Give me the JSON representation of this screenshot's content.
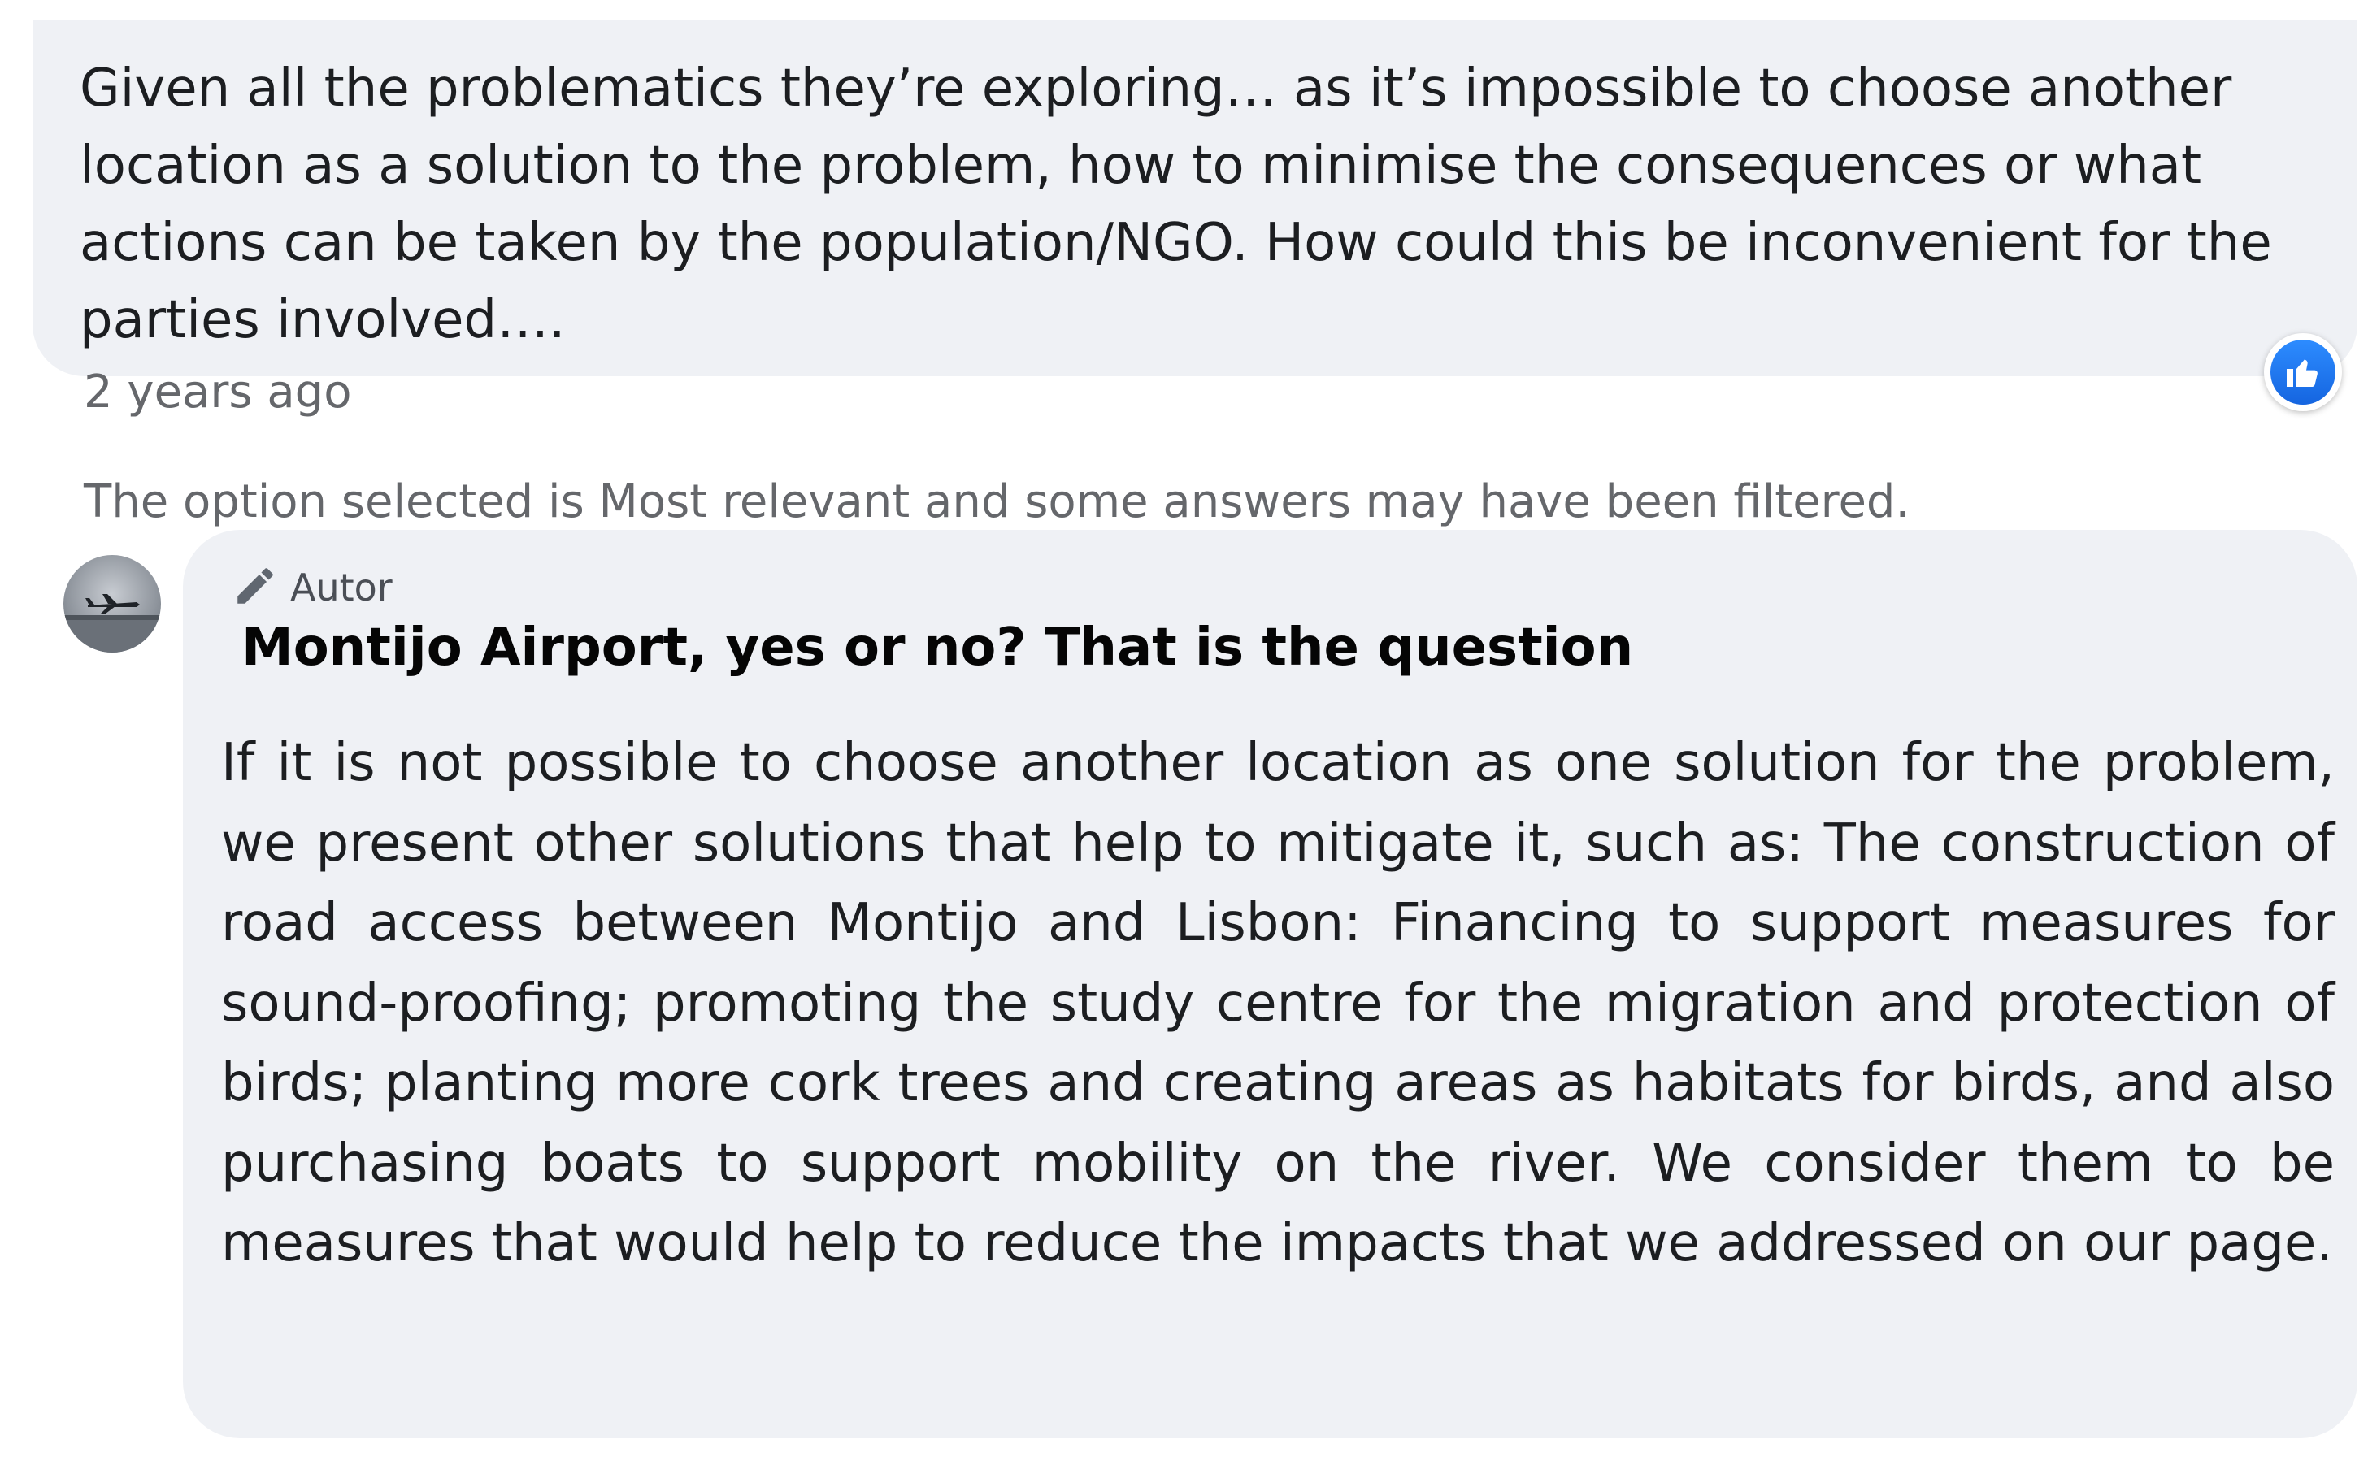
{
  "comment": {
    "text": "Given all the problematics they’re exploring… as it’s impossible to choose another location as a solution to the problem, how to minimise the consequences or what actions can be taken by the population/NGO. How could this be inconvenient for the parties involved….",
    "timestamp": "2 years ago",
    "reaction_icon": "like-icon"
  },
  "filter_note": "The option selected is Most relevant and some answers may have been filtered.",
  "reply": {
    "author_badge_icon": "pencil-icon",
    "author_label": "Autor",
    "avatar_icon": "airplane-avatar",
    "title": "Montijo Airport, yes or no? That is the question",
    "body": "If it is not possible to choose another location as one solution for the problem, we present other solutions that help to mitigate it, such as: The construction of road access between Montijo and Lisbon: Financing to support measures for sound-proofing; promoting the study centre for the migration and protection of birds; planting more cork trees and creating areas as habitats for birds, and also purchasing boats to support mobility on the river. We consider them to be measures that would help to reduce the impacts that we addressed on our page."
  },
  "colors": {
    "bubble_bg": "#eff1f5",
    "meta_text": "#65676b",
    "like_blue": "#1877f2"
  }
}
